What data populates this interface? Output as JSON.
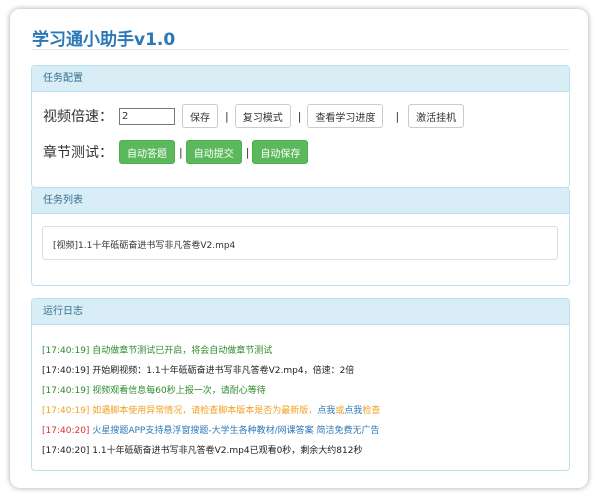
{
  "app": {
    "title": "学习通小助手v1.0"
  },
  "config": {
    "header": "任务配置",
    "speed_label": "视频倍速：",
    "speed_value": "2",
    "buttons": [
      "保存",
      "复习模式",
      "查看学习进度",
      "激活挂机"
    ],
    "chapter_label": "章节测试：",
    "chapter_buttons": [
      "自动答题",
      "自动提交",
      "自动保存"
    ],
    "separator": "|"
  },
  "tasks": {
    "header": "任务列表",
    "items": [
      "[视频]1.1十年砥砺奋进书写非凡答卷V2.mp4"
    ]
  },
  "log": {
    "header": "运行日志",
    "entries": [
      {
        "text": "[17:40:19] 自动做章节测试已开启，将会自动做章节测试",
        "color": "#2e8b2e"
      },
      {
        "text": "[17:40:19] 开始刷视频：1.1十年砥砺奋进书写非凡答卷V2.mp4，倍速：2倍",
        "color": "#222222"
      },
      {
        "text": "[17:40:19] 视频观看信息每60秒上报一次，请耐心等待",
        "color": "#2e8b2e"
      },
      {
        "text": "[17:40:19] 如遇脚本使用异常情况，请检查脚本版本是否为最新版，",
        "color": "#f0a020",
        "links": [
          "点我",
          "或",
          "点我",
          "检查"
        ]
      },
      {
        "text": "[17:40:20] ",
        "color": "#e03030",
        "link_text": "火星搜题APP支持悬浮窗搜题-大学生各种教材/网课答案 简洁免费无广告"
      },
      {
        "text": "[17:40:20] 1.1十年砥砺奋进书写非凡答卷V2.mp4已观看0秒，剩余大约812秒",
        "color": "#222222"
      }
    ]
  },
  "colors": {
    "accent": "#2b78b8",
    "green": "#5cb85c",
    "link": "#2b78b8"
  }
}
